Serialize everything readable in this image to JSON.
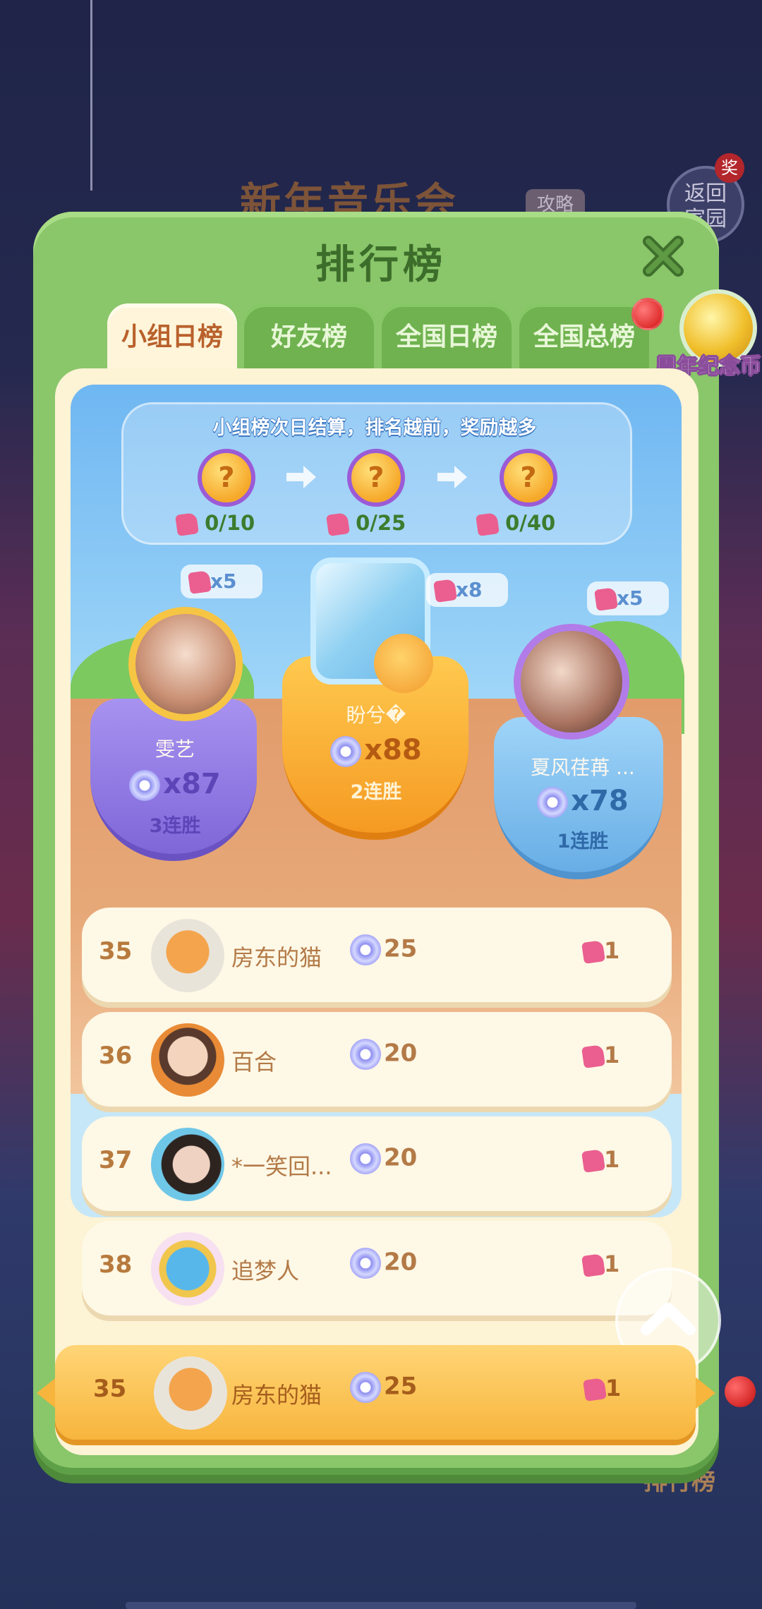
{
  "background": {
    "event_title": "新年音乐会",
    "guide_badge": "攻略",
    "return_button": "返回\n家园",
    "prize_badge": "奖",
    "rank_label": "排行榜"
  },
  "dialog": {
    "title": "排行榜",
    "tabs": [
      {
        "label": "小组日榜",
        "active": true
      },
      {
        "label": "好友榜",
        "active": false
      },
      {
        "label": "全国日榜",
        "active": false
      },
      {
        "label": "全国总榜",
        "active": false
      }
    ],
    "anniversary_coin_label": "周年纪念币",
    "reward_info": {
      "title": "小组榜次日结算，排名越前，奖励越多",
      "tiers": [
        {
          "progress": "0/10"
        },
        {
          "progress": "0/25"
        },
        {
          "progress": "0/40"
        }
      ]
    },
    "podium": [
      {
        "place": 1,
        "name": "盼兮�",
        "score": "x88",
        "streak": "2连胜",
        "reward": "x8"
      },
      {
        "place": 2,
        "name": "雯艺",
        "score": "x87",
        "streak": "3连胜",
        "reward": "x5"
      },
      {
        "place": 3,
        "name": "夏风荏苒 ...",
        "score": "x78",
        "streak": "1连胜",
        "reward": "x5"
      }
    ],
    "ranking_rows": [
      {
        "rank": "35",
        "name": "房东的猫",
        "score": "25",
        "pieces": "1"
      },
      {
        "rank": "36",
        "name": "百合",
        "score": "20",
        "pieces": "1"
      },
      {
        "rank": "37",
        "name": "*一笑回...",
        "score": "20",
        "pieces": "1"
      },
      {
        "rank": "38",
        "name": "追梦人",
        "score": "20",
        "pieces": "1"
      }
    ],
    "self_row": {
      "rank": "35",
      "name": "房东的猫",
      "score": "25",
      "pieces": "1"
    }
  },
  "colors": {
    "frame_green": "#8ac66a",
    "active_tab": "#fef5da",
    "title_green": "#3c6d2a",
    "gold": "#f7b53d",
    "purple": "#7f67d8",
    "blue": "#68aee6"
  },
  "icons": [
    "close-icon",
    "chest-icon",
    "arrow-right-icon",
    "puzzle-piece-icon",
    "music-disc-icon",
    "crystal-icon",
    "scroll-up-icon"
  ]
}
